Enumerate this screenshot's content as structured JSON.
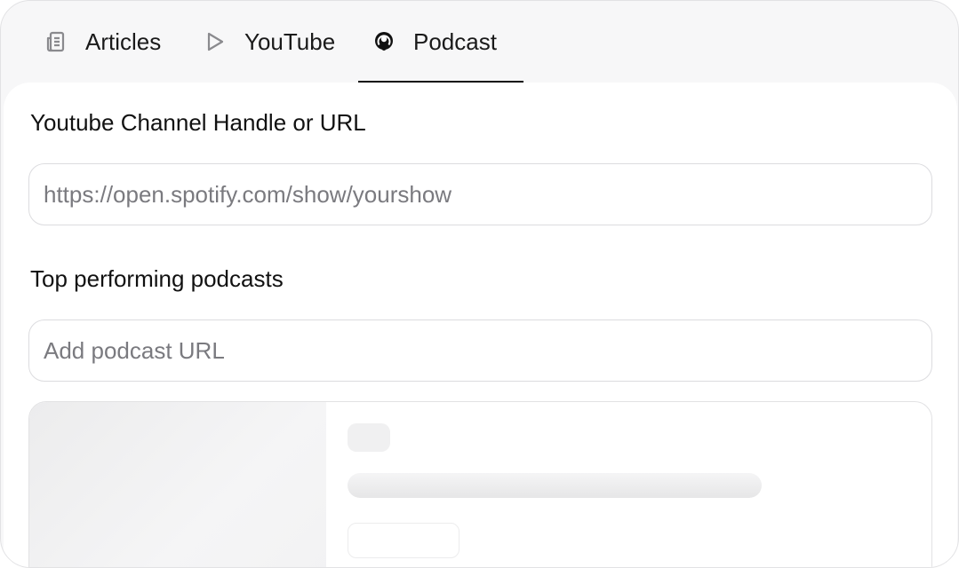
{
  "tabs": [
    {
      "label": "Articles",
      "icon": "articles-icon",
      "active": false
    },
    {
      "label": "YouTube",
      "icon": "play-icon",
      "active": false
    },
    {
      "label": "Podcast",
      "icon": "podcast-icon",
      "active": true
    }
  ],
  "form": {
    "channel_label": "Youtube Channel Handle or URL",
    "channel_placeholder": "https://open.spotify.com/show/yourshow",
    "channel_value": "",
    "top_label": "Top performing podcasts",
    "top_placeholder": "Add podcast URL",
    "top_value": ""
  },
  "colors": {
    "active_tab_underline": "#111111",
    "page_background": "#f7f7f8",
    "panel_background": "#ffffff"
  }
}
